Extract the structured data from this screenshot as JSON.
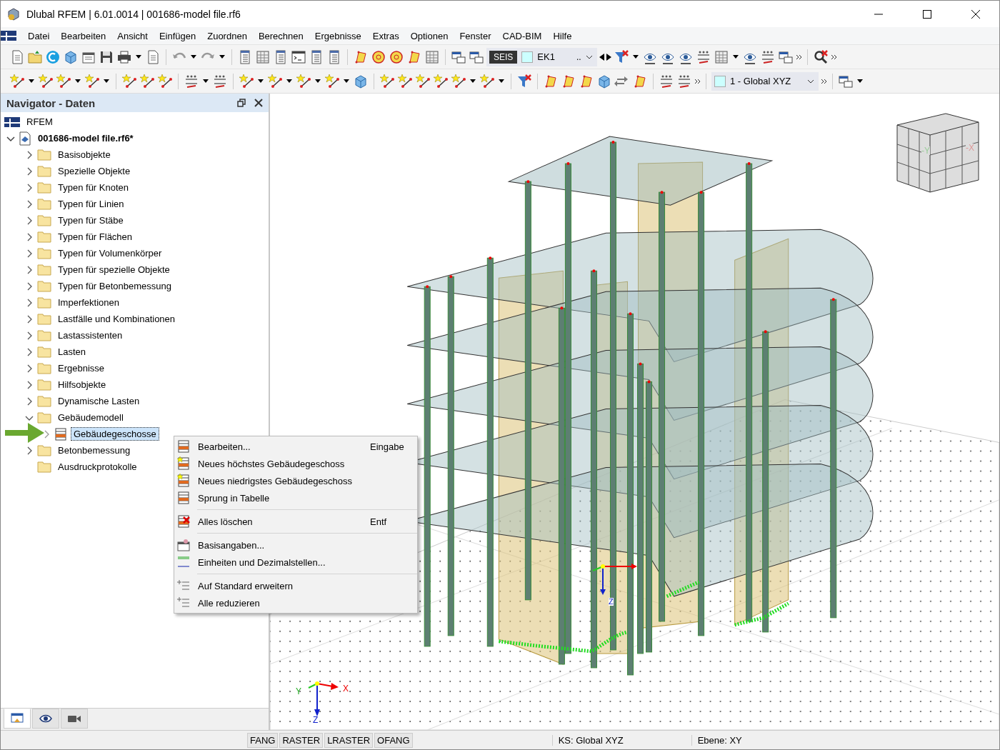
{
  "window": {
    "title": "Dlubal RFEM | 6.01.0014 | 001686-model file.rf6"
  },
  "menu": [
    "Datei",
    "Bearbeiten",
    "Ansicht",
    "Einfügen",
    "Zuordnen",
    "Berechnen",
    "Ergebnisse",
    "Extras",
    "Optionen",
    "Fenster",
    "CAD-BIM",
    "Hilfe"
  ],
  "toolbar": {
    "load_case": {
      "type": "SEIS",
      "name": "EK1",
      "more": ".."
    },
    "coordinate_system": "1 - Global XYZ"
  },
  "navigator": {
    "title": "Navigator - Daten",
    "root": "RFEM",
    "model": {
      "label": "001686-model file.rf6*",
      "expanded": true,
      "selected": false,
      "children": [
        {
          "label": "Basisobjekte",
          "kind": "folder",
          "expandable": true,
          "expanded": false,
          "selected": false
        },
        {
          "label": "Spezielle Objekte",
          "kind": "folder",
          "expandable": true,
          "expanded": false,
          "selected": false
        },
        {
          "label": "Typen für Knoten",
          "kind": "folder",
          "expandable": true,
          "expanded": false,
          "selected": false
        },
        {
          "label": "Typen für Linien",
          "kind": "folder",
          "expandable": true,
          "expanded": false,
          "selected": false
        },
        {
          "label": "Typen für Stäbe",
          "kind": "folder",
          "expandable": true,
          "expanded": false,
          "selected": false
        },
        {
          "label": "Typen für Flächen",
          "kind": "folder",
          "expandable": true,
          "expanded": false,
          "selected": false
        },
        {
          "label": "Typen für Volumenkörper",
          "kind": "folder",
          "expandable": true,
          "expanded": false,
          "selected": false
        },
        {
          "label": "Typen für spezielle Objekte",
          "kind": "folder",
          "expandable": true,
          "expanded": false,
          "selected": false
        },
        {
          "label": "Typen für Betonbemessung",
          "kind": "folder",
          "expandable": true,
          "expanded": false,
          "selected": false
        },
        {
          "label": "Imperfektionen",
          "kind": "folder",
          "expandable": true,
          "expanded": false,
          "selected": false
        },
        {
          "label": "Lastfälle und Kombinationen",
          "kind": "folder",
          "expandable": true,
          "expanded": false,
          "selected": false
        },
        {
          "label": "Lastassistenten",
          "kind": "folder",
          "expandable": true,
          "expanded": false,
          "selected": false
        },
        {
          "label": "Lasten",
          "kind": "folder",
          "expandable": true,
          "expanded": false,
          "selected": false
        },
        {
          "label": "Ergebnisse",
          "kind": "folder",
          "expandable": true,
          "expanded": false,
          "selected": false
        },
        {
          "label": "Hilfsobjekte",
          "kind": "folder",
          "expandable": true,
          "expanded": false,
          "selected": false
        },
        {
          "label": "Dynamische Lasten",
          "kind": "folder",
          "expandable": true,
          "expanded": false,
          "selected": false
        },
        {
          "label": "Gebäudemodell",
          "kind": "folder",
          "expandable": true,
          "expanded": true,
          "selected": false,
          "children": [
            {
              "label": "Gebäudegeschosse",
              "kind": "stories",
              "expandable": true,
              "expanded": false,
              "selected": true
            }
          ]
        },
        {
          "label": "Betonbemessung",
          "kind": "folder",
          "expandable": true,
          "expanded": false,
          "selected": false
        },
        {
          "label": "Ausdruckprotokolle",
          "kind": "folder",
          "expandable": false,
          "selected": false
        }
      ]
    },
    "bottom_tabs": [
      {
        "selected": true
      },
      {
        "selected": false
      },
      {
        "selected": false
      }
    ]
  },
  "context_menu": {
    "groups": [
      [
        {
          "label": "Bearbeiten...",
          "shortcut": "Eingabe"
        },
        {
          "label": "Neues höchstes Gebäudegeschoss"
        },
        {
          "label": "Neues niedrigstes Gebäudegeschoss"
        },
        {
          "label": "Sprung in Tabelle"
        }
      ],
      [
        {
          "label": "Alles löschen",
          "shortcut": "Entf"
        }
      ],
      [
        {
          "label": "Basisangaben..."
        },
        {
          "label": "Einheiten und Dezimalstellen..."
        }
      ],
      [
        {
          "label": "Auf Standard erweitern"
        },
        {
          "label": "Alle reduzieren"
        }
      ]
    ]
  },
  "viewport": {
    "view_cube": [
      "-Y",
      "-X"
    ],
    "model_triad": [
      "Z"
    ],
    "global_triad": [
      "X",
      "Y",
      "Z"
    ]
  },
  "status_bar": {
    "toggles": [
      "FANG",
      "RASTER",
      "LRASTER",
      "OFANG"
    ],
    "fields": [
      "KS: Global XYZ",
      "Ebene: XY"
    ]
  }
}
